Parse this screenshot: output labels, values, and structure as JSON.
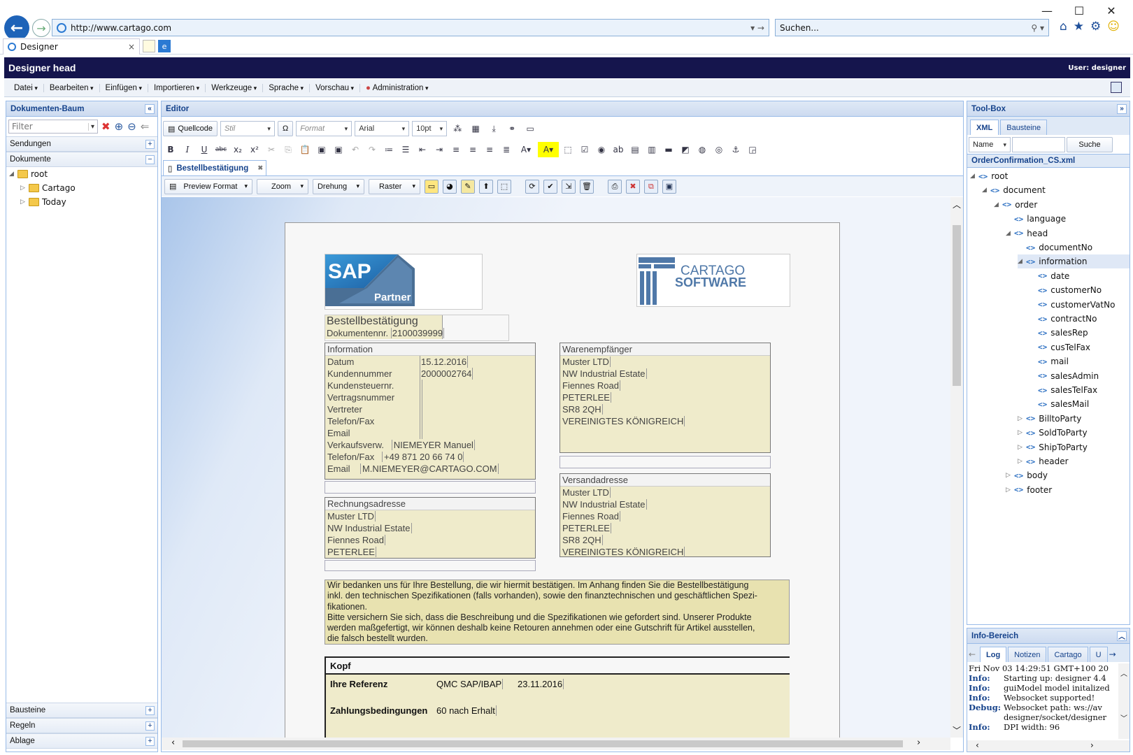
{
  "browser": {
    "url": "http://www.cartago.com",
    "search_placeholder": "Suchen...",
    "tab_title": "Designer"
  },
  "app": {
    "title": "Designer head",
    "user": "User: designer",
    "menu": [
      "Datei",
      "Bearbeiten",
      "Einfügen",
      "Importieren",
      "Werkzeuge",
      "Sprache",
      "Vorschau",
      "Administration"
    ]
  },
  "left": {
    "title": "Dokumenten-Baum",
    "filter_placeholder": "Filter",
    "sections": {
      "sendungen": "Sendungen",
      "dokumente": "Dokumente",
      "bausteine": "Bausteine",
      "regeln": "Regeln",
      "ablage": "Ablage"
    },
    "tree": {
      "root": "root",
      "child1": "Cartago",
      "child2": "Today"
    }
  },
  "editor": {
    "title": "Editor",
    "source_button": "Quellcode",
    "style_combo": "Stil",
    "format_combo": "Format",
    "font_combo": "Arial",
    "size_combo": "10pt",
    "doc_tab": "Bestellbestätigung",
    "preview_format": "Preview Format",
    "zoom": "Zoom",
    "rotation": "Drehung",
    "grid": "Raster"
  },
  "document": {
    "sap_text": "SAP",
    "partner_text": "Partner",
    "cartago_line1": "CARTAGO",
    "cartago_line2": "SOFTWARE",
    "doc_title": "Bestellbestätigung",
    "doc_no_label": "Dokumentennr.",
    "doc_no": "2100039999",
    "info": {
      "header": "Information",
      "rows": [
        {
          "k": "Datum",
          "v": "15.12.2016"
        },
        {
          "k": "Kundennummer",
          "v": "2000002764"
        },
        {
          "k": "Kundensteuernr.",
          "v": ""
        },
        {
          "k": "Vertragsnummer",
          "v": ""
        },
        {
          "k": "Vertreter",
          "v": ""
        },
        {
          "k": "Telefon/Fax",
          "v": ""
        },
        {
          "k": "Email",
          "v": ""
        }
      ],
      "sales_label": "Verkaufsverw.",
      "sales_name": "NIEMEYER Manuel",
      "sales_tel_label": "Telefon/Fax",
      "sales_tel": "+49 871 20 66 74 0",
      "sales_mail_label": "Email",
      "sales_mail": "M.NIEMEYER@CARTAGO.COM"
    },
    "ship_to": {
      "header": "Warenempfänger",
      "lines": [
        "Muster LTD",
        "NW Industrial Estate",
        "Fiennes Road",
        "PETERLEE",
        "SR8 2QH",
        "VEREINIGTES KÖNIGREICH"
      ]
    },
    "bill_to": {
      "header": "Rechnungsadresse",
      "lines": [
        "Muster LTD",
        "NW Industrial Estate",
        "Fiennes Road",
        "PETERLEE"
      ]
    },
    "ship_addr": {
      "header": "Versandadresse",
      "lines": [
        "Muster LTD",
        "NW Industrial Estate",
        "Fiennes Road",
        "PETERLEE",
        "SR8 2QH",
        "VEREINIGTES KÖNIGREICH"
      ]
    },
    "thanks": [
      "Wir bedanken uns für Ihre Bestellung, die wir hiermit bestätigen. Im Anhang finden Sie die Bestellbestätigung",
      "inkl. den technischen Spezifikationen (falls vorhanden), sowie den finanztechnischen und geschäftlichen Spezi-",
      "fikationen.",
      "Bitte versichern Sie sich, dass die Beschreibung und die Spezifikationen wie gefordert sind. Unserer Produkte",
      "werden maßgefertigt, wir können deshalb keine Retouren annehmen oder eine Gutschrift für Artikel ausstellen,",
      "die falsch bestellt wurden."
    ],
    "kopf": {
      "title": "Kopf",
      "ref_label": "Ihre Referenz",
      "ref_value": "QMC SAP/IBAP",
      "ref_date": "23.11.2016",
      "pay_label": "Zahlungsbedingungen",
      "pay_value": "60 nach Erhalt"
    }
  },
  "right": {
    "title": "Tool-Box",
    "tabs": [
      "XML",
      "Bausteine"
    ],
    "search_field": "Name",
    "search_button": "Suche",
    "file": "OrderConfirmation_CS.xml",
    "tree": [
      {
        "label": "root",
        "depth": 0,
        "state": "open"
      },
      {
        "label": "document",
        "depth": 1,
        "state": "open"
      },
      {
        "label": "order",
        "depth": 2,
        "state": "open"
      },
      {
        "label": "language",
        "depth": 3,
        "state": "leaf"
      },
      {
        "label": "head",
        "depth": 3,
        "state": "open"
      },
      {
        "label": "documentNo",
        "depth": 4,
        "state": "leaf"
      },
      {
        "label": "information",
        "depth": 4,
        "state": "open",
        "selected": true
      },
      {
        "label": "date",
        "depth": 5,
        "state": "leaf"
      },
      {
        "label": "customerNo",
        "depth": 5,
        "state": "leaf"
      },
      {
        "label": "customerVatNo",
        "depth": 5,
        "state": "leaf"
      },
      {
        "label": "contractNo",
        "depth": 5,
        "state": "leaf"
      },
      {
        "label": "salesRep",
        "depth": 5,
        "state": "leaf"
      },
      {
        "label": "cusTelFax",
        "depth": 5,
        "state": "leaf"
      },
      {
        "label": "mail",
        "depth": 5,
        "state": "leaf"
      },
      {
        "label": "salesAdmin",
        "depth": 5,
        "state": "leaf"
      },
      {
        "label": "salesTelFax",
        "depth": 5,
        "state": "leaf"
      },
      {
        "label": "salesMail",
        "depth": 5,
        "state": "leaf"
      },
      {
        "label": "BilltoParty",
        "depth": 4,
        "state": "closed"
      },
      {
        "label": "SoldToParty",
        "depth": 4,
        "state": "closed"
      },
      {
        "label": "ShipToParty",
        "depth": 4,
        "state": "closed"
      },
      {
        "label": "header",
        "depth": 4,
        "state": "closed"
      },
      {
        "label": "body",
        "depth": 3,
        "state": "closed"
      },
      {
        "label": "footer",
        "depth": 3,
        "state": "closed"
      }
    ]
  },
  "info": {
    "title": "Info-Bereich",
    "tabs": [
      "Log",
      "Notizen",
      "Cartago",
      "U"
    ],
    "log": [
      {
        "level": "",
        "text": "Fri Nov 03 14:29:51 GMT+100 20"
      },
      {
        "level": "Info:",
        "text": "Starting up: designer 4.4"
      },
      {
        "level": "Info:",
        "text": "guiModel model initalized"
      },
      {
        "level": "Info:",
        "text": "Websocket supported!"
      },
      {
        "level": "Debug:",
        "text": "Websocket path: ws://av"
      },
      {
        "level": "",
        "text": "designer/socket/designer"
      },
      {
        "level": "Info:",
        "text": "DPI width: 96"
      }
    ]
  }
}
